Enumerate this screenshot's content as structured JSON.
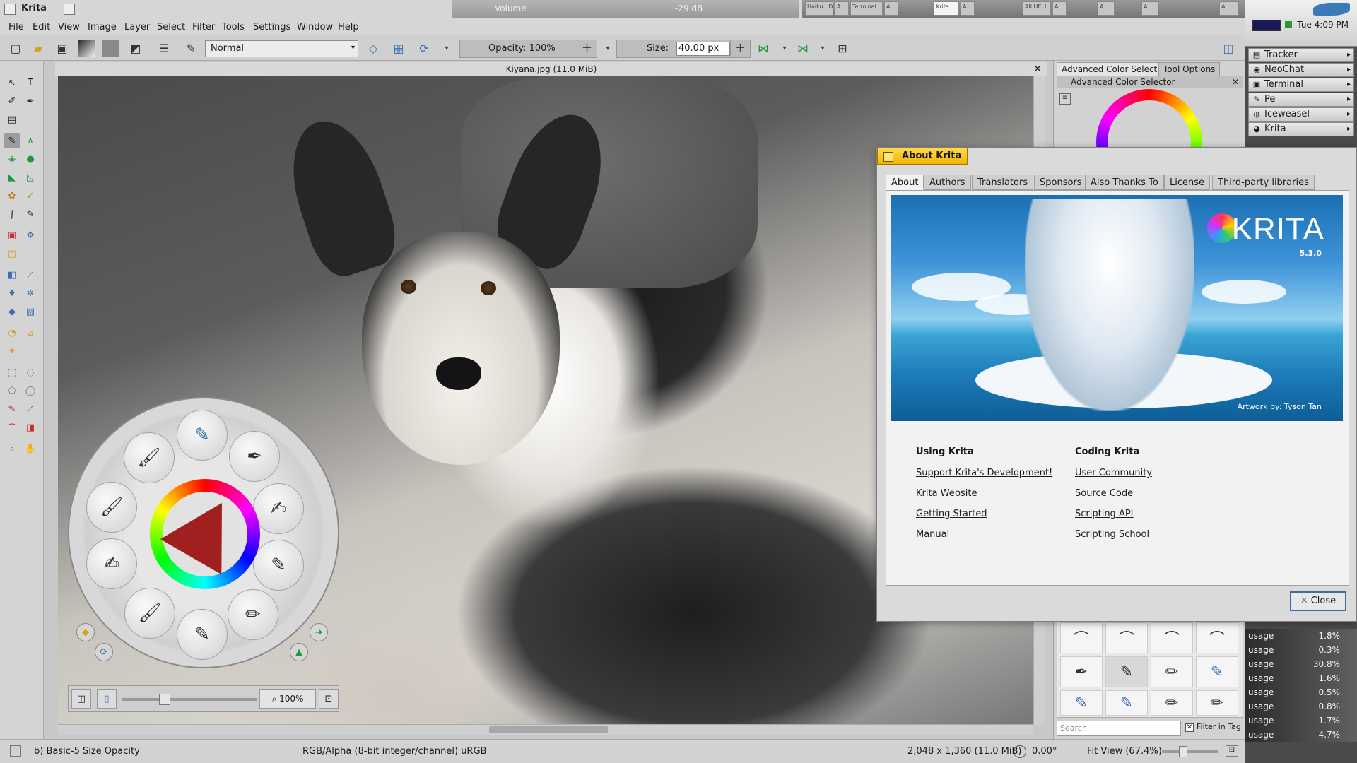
{
  "window": {
    "app_title": "Krita",
    "volume_label": "Volume",
    "volume_value": "-29 dB",
    "tasks": [
      "Haiku · De",
      "A..",
      "Terminal",
      "A..",
      "Krita",
      "A..",
      "All HELL E",
      "A..",
      "A..",
      "A..",
      "A.."
    ]
  },
  "menu": [
    "File",
    "Edit",
    "View",
    "Image",
    "Layer",
    "Select",
    "Filter",
    "Tools",
    "Settings",
    "Window",
    "Help"
  ],
  "toolbar": {
    "blend_mode": "Normal",
    "opacity": "Opacity: 100%",
    "size_label": "Size:",
    "size_value": "40.00 px",
    "stepper": "+"
  },
  "document": {
    "title": "Kiyana.jpg (11.0 MiB)",
    "close": "✕"
  },
  "popup_palette": {
    "zoom": "100%"
  },
  "dockers": {
    "tab_active": "Advanced Color Selector",
    "tab_other": "Tool Options",
    "acs_header": "Advanced Color Selector",
    "search_placeholder": "Search",
    "filter_label": "Filter in Tag"
  },
  "system": {
    "clock": "Tue 4:09 PM",
    "launchers": [
      {
        "label": "Tracker",
        "icon": "tracker-icon"
      },
      {
        "label": "NeoChat",
        "icon": "chat-icon"
      },
      {
        "label": "Terminal",
        "icon": "terminal-icon"
      },
      {
        "label": "Pe",
        "icon": "pe-icon"
      },
      {
        "label": "Iceweasel",
        "icon": "browser-icon"
      },
      {
        "label": "Krita",
        "icon": "krita-icon"
      }
    ],
    "cpu": [
      {
        "label": "usage",
        "value": "1.8%"
      },
      {
        "label": "usage",
        "value": "0.3%"
      },
      {
        "label": "usage",
        "value": "30.8%"
      },
      {
        "label": "usage",
        "value": "1.6%"
      },
      {
        "label": "usage",
        "value": "0.5%"
      },
      {
        "label": "usage",
        "value": "0.8%"
      },
      {
        "label": "usage",
        "value": "1.7%"
      },
      {
        "label": "usage",
        "value": "4.7%"
      }
    ]
  },
  "status": {
    "brush": "b) Basic-5 Size Opacity",
    "colorspace": "RGB/Alpha (8-bit integer/channel)  uRGB",
    "dimensions": "2,048 x 1,360 (11.0 MiB)",
    "rotation": "0.00°",
    "fit": "Fit View (67.4%)"
  },
  "about": {
    "title": "About Krita",
    "tabs": [
      "About",
      "Authors",
      "Translators",
      "Sponsors",
      "Also Thanks To",
      "License",
      "Third-party libraries"
    ],
    "logo": "KRITA",
    "version": "5.3.0",
    "credit": "Artwork by: Tyson Tan",
    "using_head": "Using Krita",
    "using_links": [
      "Support Krita's Development!",
      "Krita Website",
      "Getting Started",
      "Manual"
    ],
    "coding_head": "Coding Krita",
    "coding_links": [
      "User Community",
      "Source Code",
      "Scripting API",
      "Scripting School"
    ],
    "close_label": "Close"
  },
  "colors": {
    "accent_title": "#f2b500",
    "focus_border": "#3a6ea5"
  }
}
